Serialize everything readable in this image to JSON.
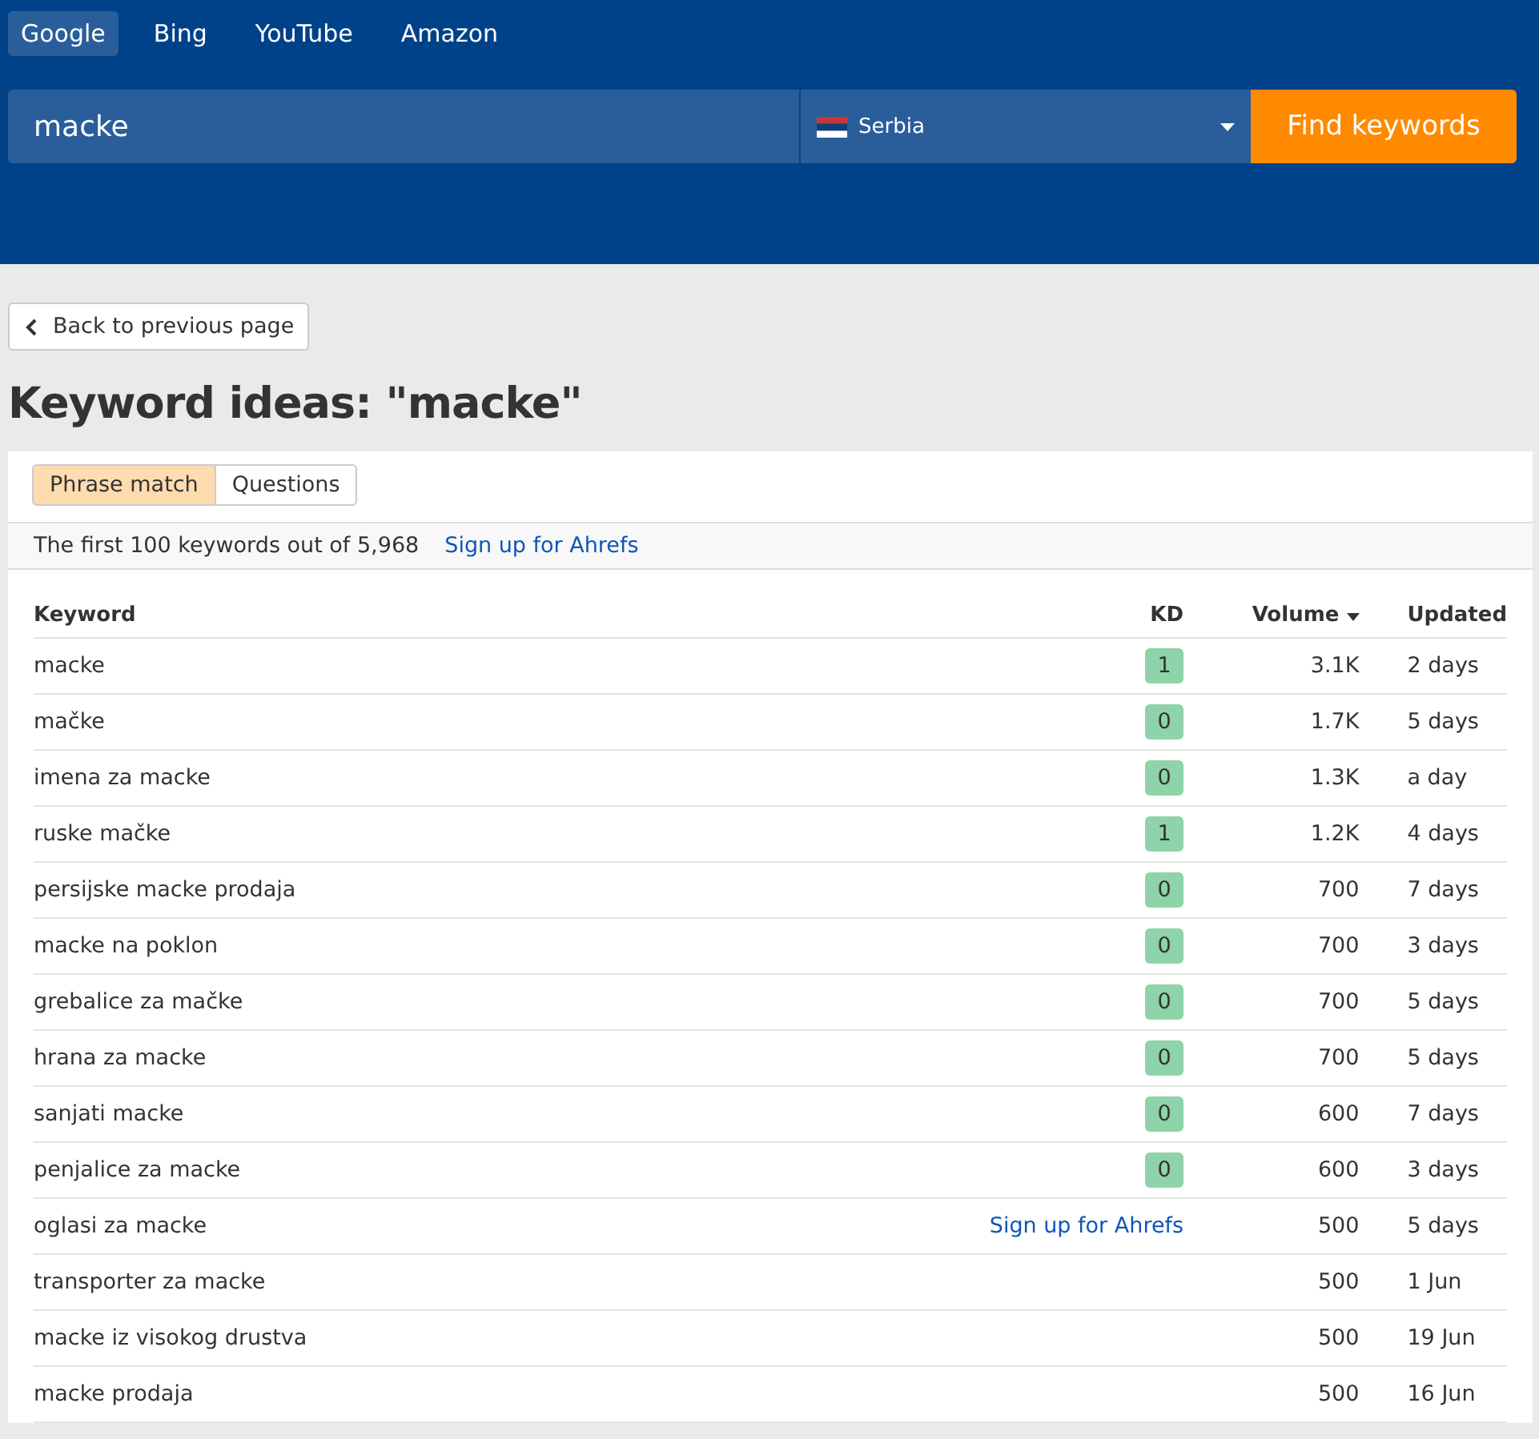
{
  "engines": [
    {
      "label": "Google",
      "selected": true
    },
    {
      "label": "Bing",
      "selected": false
    },
    {
      "label": "YouTube",
      "selected": false
    },
    {
      "label": "Amazon",
      "selected": false
    }
  ],
  "search": {
    "value": "macke",
    "country": "Serbia",
    "button": "Find keywords"
  },
  "back_button": "Back to previous page",
  "heading": "Keyword ideas: \"macke\"",
  "match_tabs": [
    {
      "label": "Phrase match",
      "selected": true
    },
    {
      "label": "Questions",
      "selected": false
    }
  ],
  "summary": {
    "text": "The first 100 keywords out of 5,968",
    "link": "Sign up for Ahrefs"
  },
  "table": {
    "columns": [
      "Keyword",
      "KD",
      "Volume",
      "Updated"
    ],
    "rows": [
      {
        "keyword": "macke",
        "kd": {
          "kind": "badge",
          "text": "1"
        },
        "volume": "3.1K",
        "updated": "2 days"
      },
      {
        "keyword": "mačke",
        "kd": {
          "kind": "badge",
          "text": "0"
        },
        "volume": "1.7K",
        "updated": "5 days"
      },
      {
        "keyword": "imena za macke",
        "kd": {
          "kind": "badge",
          "text": "0"
        },
        "volume": "1.3K",
        "updated": "a day"
      },
      {
        "keyword": "ruske mačke",
        "kd": {
          "kind": "badge",
          "text": "1"
        },
        "volume": "1.2K",
        "updated": "4 days"
      },
      {
        "keyword": "persijske macke prodaja",
        "kd": {
          "kind": "badge",
          "text": "0"
        },
        "volume": "700",
        "updated": "7 days"
      },
      {
        "keyword": "macke na poklon",
        "kd": {
          "kind": "badge",
          "text": "0"
        },
        "volume": "700",
        "updated": "3 days"
      },
      {
        "keyword": "grebalice za mačke",
        "kd": {
          "kind": "badge",
          "text": "0"
        },
        "volume": "700",
        "updated": "5 days"
      },
      {
        "keyword": "hrana za macke",
        "kd": {
          "kind": "badge",
          "text": "0"
        },
        "volume": "700",
        "updated": "5 days"
      },
      {
        "keyword": "sanjati macke",
        "kd": {
          "kind": "badge",
          "text": "0"
        },
        "volume": "600",
        "updated": "7 days"
      },
      {
        "keyword": "penjalice za macke",
        "kd": {
          "kind": "badge",
          "text": "0"
        },
        "volume": "600",
        "updated": "3 days"
      },
      {
        "keyword": "oglasi za macke",
        "kd": {
          "kind": "link",
          "text": "Sign up for Ahrefs"
        },
        "volume": "500",
        "updated": "5 days"
      },
      {
        "keyword": "transporter za macke",
        "kd": {
          "kind": "none"
        },
        "volume": "500",
        "updated": "1 Jun"
      },
      {
        "keyword": "macke iz visokog drustva",
        "kd": {
          "kind": "none"
        },
        "volume": "500",
        "updated": "19 Jun"
      },
      {
        "keyword": "macke prodaja",
        "kd": {
          "kind": "none"
        },
        "volume": "500",
        "updated": "16 Jun"
      }
    ]
  }
}
